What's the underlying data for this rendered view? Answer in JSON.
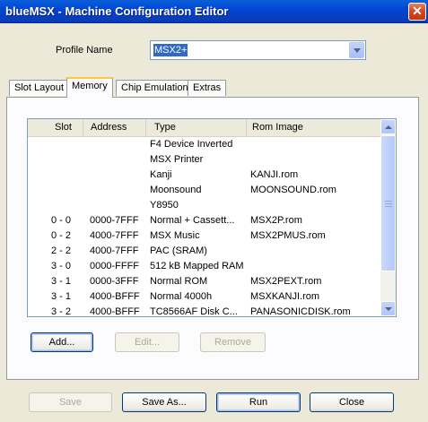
{
  "window": {
    "title": "blueMSX - Machine Configuration Editor",
    "close_icon": "close-icon"
  },
  "profile": {
    "label": "Profile Name",
    "value": "MSX2+"
  },
  "tabs": [
    {
      "label": "Slot Layout",
      "active": false
    },
    {
      "label": "Memory",
      "active": true
    },
    {
      "label": "Chip Emulation",
      "active": false
    },
    {
      "label": "Extras",
      "active": false
    }
  ],
  "table": {
    "columns": [
      "Slot",
      "Address",
      "Type",
      "Rom Image"
    ],
    "rows": [
      {
        "slot": "",
        "address": "",
        "type": "F4 Device Inverted",
        "rom": ""
      },
      {
        "slot": "",
        "address": "",
        "type": "MSX Printer",
        "rom": ""
      },
      {
        "slot": "",
        "address": "",
        "type": "Kanji",
        "rom": "KANJI.rom"
      },
      {
        "slot": "",
        "address": "",
        "type": "Moonsound",
        "rom": "MOONSOUND.rom"
      },
      {
        "slot": "",
        "address": "",
        "type": "Y8950",
        "rom": ""
      },
      {
        "slot": "0 - 0",
        "address": "0000-7FFF",
        "type": "Normal + Cassett...",
        "rom": "MSX2P.rom"
      },
      {
        "slot": "0 - 2",
        "address": "4000-7FFF",
        "type": "MSX Music",
        "rom": "MSX2PMUS.rom"
      },
      {
        "slot": "2 - 2",
        "address": "4000-7FFF",
        "type": "PAC (SRAM)",
        "rom": ""
      },
      {
        "slot": "3 - 0",
        "address": "0000-FFFF",
        "type": "512 kB Mapped RAM",
        "rom": ""
      },
      {
        "slot": "3 - 1",
        "address": "0000-3FFF",
        "type": "Normal ROM",
        "rom": "MSX2PEXT.rom"
      },
      {
        "slot": "3 - 1",
        "address": "4000-BFFF",
        "type": "Normal 4000h",
        "rom": "MSXKANJI.rom"
      },
      {
        "slot": "3 - 2",
        "address": "4000-BFFF",
        "type": "TC8566AF Disk C...",
        "rom": "PANASONICDISK.rom"
      }
    ]
  },
  "panel_buttons": {
    "add": "Add...",
    "edit": "Edit...",
    "remove": "Remove"
  },
  "footer_buttons": {
    "save": "Save",
    "save_as": "Save As...",
    "run": "Run",
    "close": "Close"
  }
}
